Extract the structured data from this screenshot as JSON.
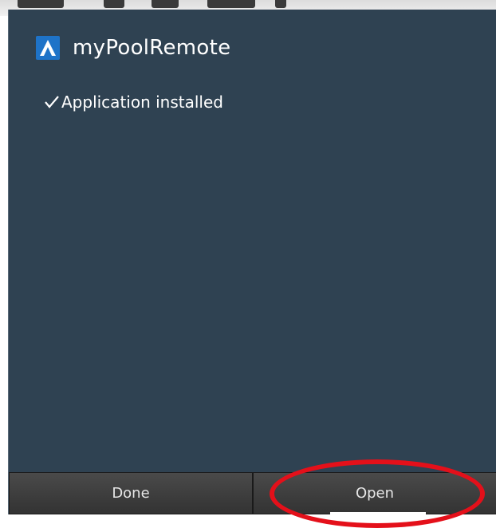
{
  "dialog": {
    "app_name": "myPoolRemote",
    "app_icon": "triangle-logo-icon",
    "status_icon": "check-icon",
    "status_text": "Application installed"
  },
  "buttons": {
    "done_label": "Done",
    "open_label": "Open"
  },
  "colors": {
    "dialog_background": "#2f4252",
    "button_bar": "#2a2a2a",
    "annotation_circle": "#e4101a",
    "icon_blue": "#1e73c8"
  }
}
